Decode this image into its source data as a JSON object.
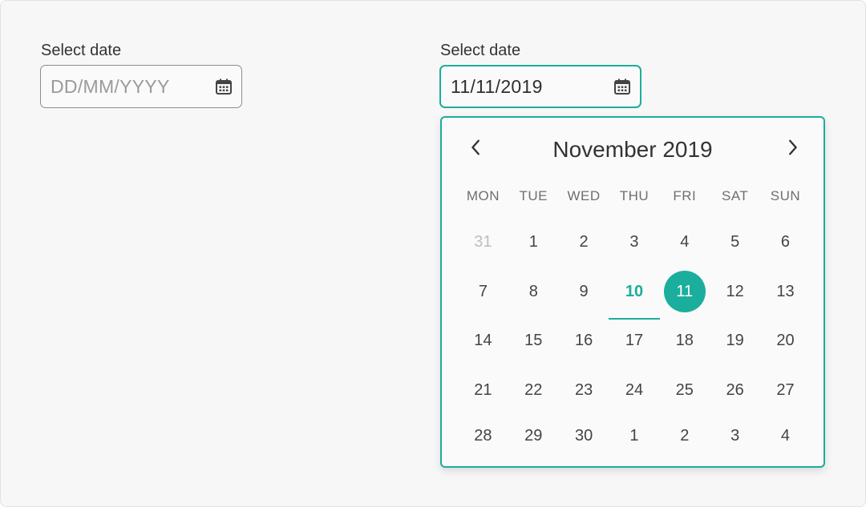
{
  "colors": {
    "accent": "#1bae9c",
    "text": "#333333",
    "muted": "#bdbdbd"
  },
  "left_picker": {
    "label": "Select date",
    "placeholder": "DD/MM/YYYY",
    "icon": "calendar-icon"
  },
  "right_picker": {
    "label": "Select date",
    "value": "11/11/2019",
    "icon": "calendar-icon"
  },
  "calendar": {
    "month_title": "November 2019",
    "prev_icon": "chevron-left-icon",
    "next_icon": "chevron-right-icon",
    "weekdays": [
      "MON",
      "TUE",
      "WED",
      "THU",
      "FRI",
      "SAT",
      "SUN"
    ],
    "weeks": [
      [
        "31",
        "1",
        "2",
        "3",
        "4",
        "5",
        "6"
      ],
      [
        "7",
        "8",
        "9",
        "10",
        "11",
        "12",
        "13"
      ],
      [
        "14",
        "15",
        "16",
        "17",
        "18",
        "19",
        "20"
      ],
      [
        "21",
        "22",
        "23",
        "24",
        "25",
        "26",
        "27"
      ],
      [
        "28",
        "29",
        "30",
        "1",
        "2",
        "3",
        "4"
      ]
    ],
    "today": "10",
    "selected": "11"
  }
}
